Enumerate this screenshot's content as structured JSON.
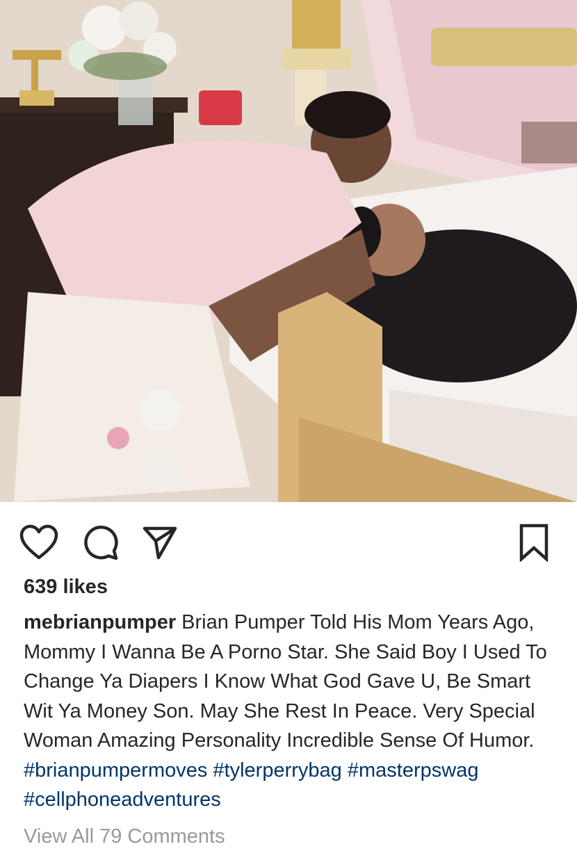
{
  "post": {
    "likes_label": "639 likes",
    "username": "mebrianpumper",
    "caption_text": "Brian Pumper Told His Mom Years Ago, Mommy I Wanna Be A Porno Star. She Said Boy I Used To Change Ya Diapers I Know What God Gave U, Be Smart Wit Ya Money Son. May She Rest In Peace. Very Special Woman Amazing Personality Incredible Sense Of Humor.",
    "hashtags": [
      "#brianpumpermoves",
      "#tylerperrybag",
      "#masterpswag",
      "#cellphoneadventures"
    ],
    "view_comments_label": "View All 79 Comments"
  },
  "actions": {
    "like_icon": "heart-icon",
    "comment_icon": "comment-bubble-icon",
    "share_icon": "paper-plane-icon",
    "save_icon": "bookmark-icon"
  },
  "colors": {
    "text": "#262626",
    "hashtag": "#003569",
    "muted": "#999999",
    "icon": "#262626"
  }
}
